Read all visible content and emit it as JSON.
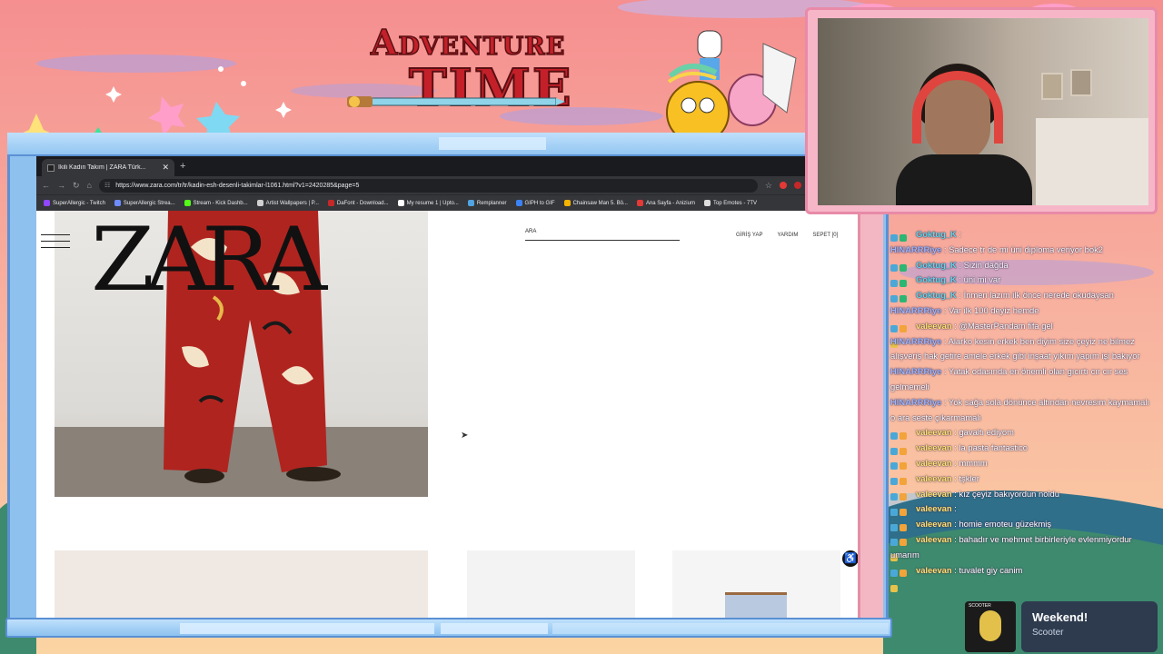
{
  "overlay": {
    "logo_line1": "Adventure",
    "logo_line2": "TIME"
  },
  "browser": {
    "tab_title": "İkili Kadın Takım | ZARA Türk...",
    "url": "https://www.zara.com/tr/tr/kadin-esh-desenli-takimlar-l1061.html?v1=2420285&page=5",
    "bookmarks": [
      {
        "label": "SuperAllergic - Twitch",
        "color": "#9146ff"
      },
      {
        "label": "SuperAllergic Strea...",
        "color": "#6d8cff"
      },
      {
        "label": "Stream - Kick Dashb...",
        "color": "#53fc18"
      },
      {
        "label": "Artist Wallpapers | P...",
        "color": "#d0d0d0"
      },
      {
        "label": "DaFont - Download...",
        "color": "#c62828"
      },
      {
        "label": "My resume 1 | Upto...",
        "color": "#ffffff"
      },
      {
        "label": "Remplanner",
        "color": "#4fa3e0"
      },
      {
        "label": "GIPH to GIF",
        "color": "#3b82f6"
      },
      {
        "label": "Chainsaw Man 5. Bö...",
        "color": "#f4b400"
      },
      {
        "label": "Ana Sayfa - Anizium",
        "color": "#e53935"
      },
      {
        "label": "Top Emotes - 7TV",
        "color": "#dddddd"
      }
    ]
  },
  "zara": {
    "logo": "ZARA",
    "search_placeholder": "ARA",
    "links": {
      "login": "GİRİŞ YAP",
      "help": "YARDIM",
      "cart": "SEPET [0]"
    }
  },
  "chat": {
    "messages": [
      {
        "user": "Goktug_K",
        "cls": "u-gok",
        "text": "",
        "badges": [
          "#4aa8d8",
          "#2bb673"
        ]
      },
      {
        "user": "HINARRRiye",
        "cls": "u-hin",
        "text": "Sadece tr de mi üni diploma veriyor bok2",
        "badges": []
      },
      {
        "user": "Goktug_K",
        "cls": "u-gok",
        "text": "Sizin dağda",
        "badges": [
          "#4aa8d8",
          "#2bb673"
        ]
      },
      {
        "user": "Goktug_K",
        "cls": "u-gok",
        "text": "üni mi var",
        "badges": [
          "#4aa8d8",
          "#2bb673"
        ]
      },
      {
        "user": "Goktug_K",
        "cls": "u-gok",
        "text": "İnmen lazım ilk önce nerede okudaysan",
        "badges": [
          "#4aa8d8",
          "#2bb673"
        ]
      },
      {
        "user": "HINARRRiye",
        "cls": "u-hin",
        "text": "Var ilk 100 deyiz hemde",
        "badges": []
      },
      {
        "user": "valeevan",
        "cls": "u-val",
        "text": "@MasterPandam fifa gel",
        "badges": [
          "#4aa8d8",
          "#f2a33a",
          "#e7c24a"
        ]
      },
      {
        "user": "HINARRRiye",
        "cls": "u-hin",
        "text": "Alarko kesin erkek ben diyim size çeyiz ne bilmez alışveriş hak getire amele erkek gibi inşaat yıkım yapım işi bakıyor",
        "badges": []
      },
      {
        "user": "HINARRRiye",
        "cls": "u-hin",
        "text": "Yatak odasında en önemli olan gıcırtı cır cır ses gelmemeli",
        "badges": []
      },
      {
        "user": "HINARRRiye",
        "cls": "u-hin",
        "text": "Yok sağa sola dönünce altından nevresim kaymamalı o ara seste çıkarmamalı",
        "badges": []
      },
      {
        "user": "valeevan",
        "cls": "u-val",
        "text": "gavaltı ediyom",
        "badges": [
          "#4aa8d8",
          "#f2a33a",
          "#e7c24a"
        ]
      },
      {
        "user": "valeevan",
        "cls": "u-val",
        "text": "la pasta fantastico",
        "badges": [
          "#4aa8d8",
          "#f2a33a",
          "#e7c24a"
        ]
      },
      {
        "user": "valeevan",
        "cls": "u-val",
        "text": "mmmm",
        "badges": [
          "#4aa8d8",
          "#f2a33a",
          "#e7c24a"
        ]
      },
      {
        "user": "valeevan",
        "cls": "u-val",
        "text": "tşkler",
        "badges": [
          "#4aa8d8",
          "#f2a33a",
          "#e7c24a"
        ]
      },
      {
        "user": "valeevan",
        "cls": "u-val",
        "text": "kız çeyiz bakıyordun noldu",
        "badges": [
          "#4aa8d8",
          "#f2a33a",
          "#e7c24a"
        ]
      },
      {
        "user": "valeevan",
        "cls": "u-val",
        "text": "",
        "badges": [
          "#4aa8d8",
          "#f2a33a",
          "#e7c24a"
        ]
      },
      {
        "user": "valeevan",
        "cls": "u-val",
        "text": "homie emoteu güzekmiş",
        "badges": [
          "#4aa8d8",
          "#f2a33a",
          "#e7c24a"
        ]
      },
      {
        "user": "valeevan",
        "cls": "u-val",
        "text": "bahadır ve mehmet birbirleriyle evlenmiyordur umarım",
        "badges": [
          "#4aa8d8",
          "#f2a33a",
          "#e7c24a"
        ]
      },
      {
        "user": "valeevan",
        "cls": "u-val",
        "text": "tuvalet giy canim",
        "badges": [
          "#4aa8d8",
          "#f2a33a",
          "#e7c24a"
        ]
      }
    ]
  },
  "now_playing": {
    "cover_label": "SCOOTER",
    "title": "Weekend!",
    "artist": "Scooter"
  }
}
